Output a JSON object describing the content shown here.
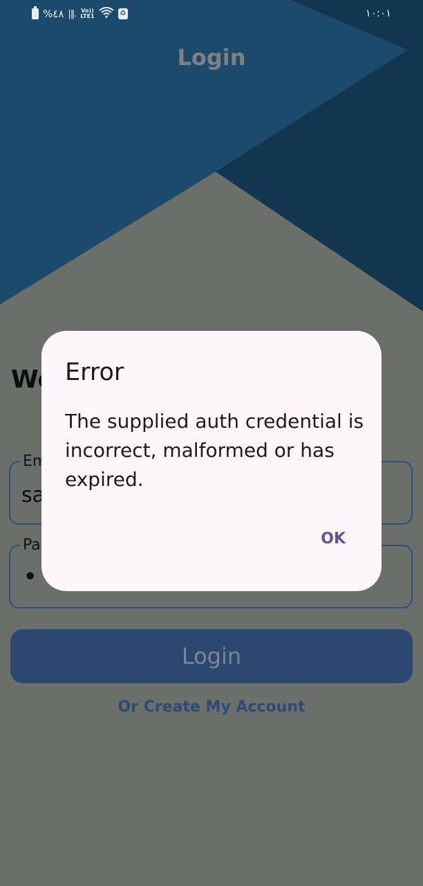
{
  "status_bar": {
    "battery_percent": "%٤٨",
    "volte_top": "Vo))",
    "volte_bottom": "LTE1",
    "time": "١٠:٠١"
  },
  "header": {
    "title": "Login"
  },
  "form": {
    "welcome_text": "We",
    "email_label": "Em",
    "email_value": "sa",
    "password_label": "Pa",
    "password_dots": "••",
    "login_button": "Login",
    "create_account_link": "Or Create My Account"
  },
  "dialog": {
    "title": "Error",
    "message": "The supplied auth credential is incorrect, malformed or has expired.",
    "ok_button": "OK"
  },
  "colors": {
    "header_blue": "#1c4a6d",
    "header_dark": "#123550",
    "scrim": "#6b6f69",
    "dialog_bg": "#fdf7fc",
    "accent": "#65558f",
    "button_bg": "#2c4871"
  }
}
